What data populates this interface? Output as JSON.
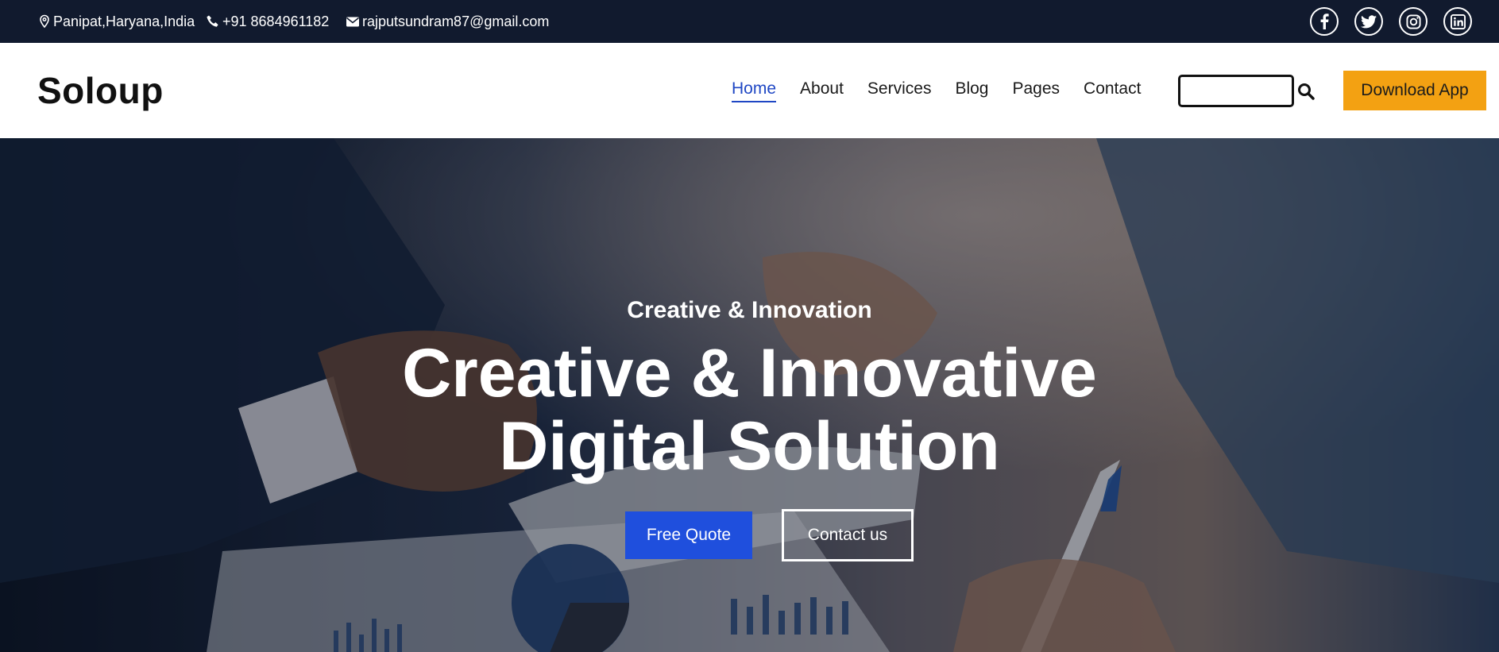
{
  "topbar": {
    "location": "Panipat,Haryana,India",
    "phone": "+91 8684961182",
    "email": "rajputsundram87@gmail.com",
    "socials": [
      "facebook-icon",
      "twitter-icon",
      "instagram-icon",
      "linkedin-icon"
    ]
  },
  "header": {
    "logo": "Soloup",
    "nav": [
      "Home",
      "About",
      "Services",
      "Blog",
      "Pages",
      "Contact"
    ],
    "active_nav": "Home",
    "search": {
      "value": "",
      "placeholder": ""
    },
    "download_label": "Download App"
  },
  "hero": {
    "subtitle": "Creative & Innovation",
    "title_line1": "Creative & Innovative",
    "title_line2": "Digital Solution",
    "primary_button": "Free Quote",
    "secondary_button": "Contact us"
  },
  "colors": {
    "topbar_bg": "#111a2e",
    "accent_blue": "#1f47c4",
    "download_bg": "#f3a112",
    "quote_button": "#1f4fdd"
  }
}
